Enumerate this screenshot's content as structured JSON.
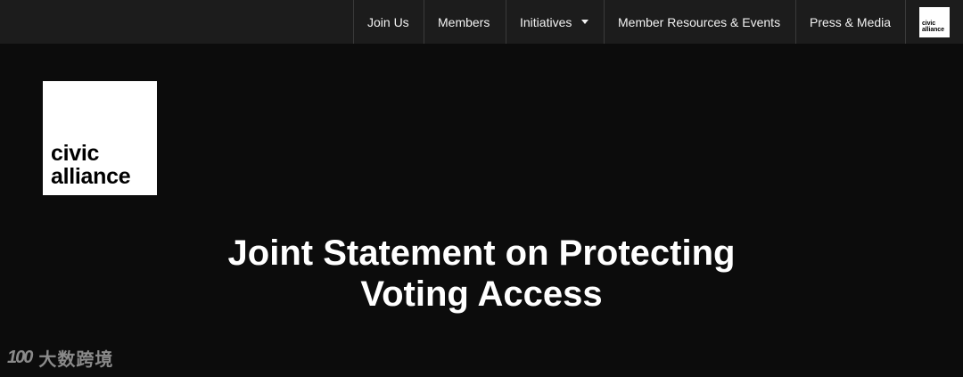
{
  "nav": {
    "items": [
      {
        "label": "Join Us"
      },
      {
        "label": "Members"
      },
      {
        "label": "Initiatives"
      },
      {
        "label": "Member Resources & Events"
      },
      {
        "label": "Press & Media"
      }
    ],
    "logo_line1": "civic",
    "logo_line2": "alliance"
  },
  "hero": {
    "logo_line1": "civic",
    "logo_line2": "alliance",
    "title_line1": "Joint Statement on Protecting",
    "title_line2": "Voting Access"
  },
  "watermark": {
    "mark": "100",
    "text": "大数跨境"
  },
  "colors": {
    "background": "#0c0c0c",
    "topbar": "#1c1c1c",
    "text": "#ffffff",
    "logo_bg": "#ffffff"
  }
}
